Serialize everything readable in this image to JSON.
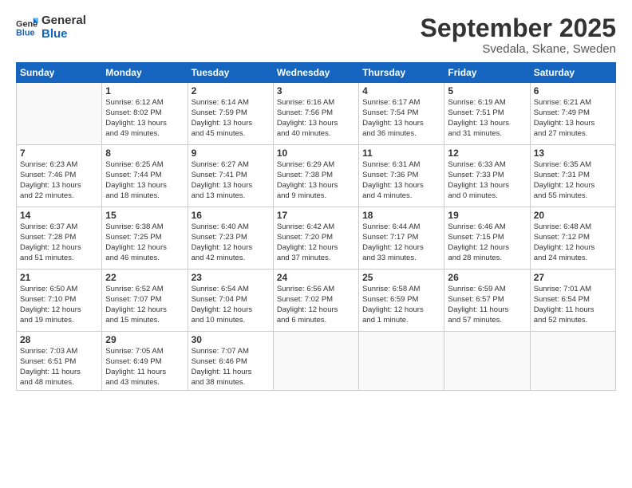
{
  "logo": {
    "line1": "General",
    "line2": "Blue"
  },
  "title": "September 2025",
  "subtitle": "Svedala, Skane, Sweden",
  "days_header": [
    "Sunday",
    "Monday",
    "Tuesday",
    "Wednesday",
    "Thursday",
    "Friday",
    "Saturday"
  ],
  "weeks": [
    [
      {
        "num": "",
        "info": ""
      },
      {
        "num": "1",
        "info": "Sunrise: 6:12 AM\nSunset: 8:02 PM\nDaylight: 13 hours\nand 49 minutes."
      },
      {
        "num": "2",
        "info": "Sunrise: 6:14 AM\nSunset: 7:59 PM\nDaylight: 13 hours\nand 45 minutes."
      },
      {
        "num": "3",
        "info": "Sunrise: 6:16 AM\nSunset: 7:56 PM\nDaylight: 13 hours\nand 40 minutes."
      },
      {
        "num": "4",
        "info": "Sunrise: 6:17 AM\nSunset: 7:54 PM\nDaylight: 13 hours\nand 36 minutes."
      },
      {
        "num": "5",
        "info": "Sunrise: 6:19 AM\nSunset: 7:51 PM\nDaylight: 13 hours\nand 31 minutes."
      },
      {
        "num": "6",
        "info": "Sunrise: 6:21 AM\nSunset: 7:49 PM\nDaylight: 13 hours\nand 27 minutes."
      }
    ],
    [
      {
        "num": "7",
        "info": "Sunrise: 6:23 AM\nSunset: 7:46 PM\nDaylight: 13 hours\nand 22 minutes."
      },
      {
        "num": "8",
        "info": "Sunrise: 6:25 AM\nSunset: 7:44 PM\nDaylight: 13 hours\nand 18 minutes."
      },
      {
        "num": "9",
        "info": "Sunrise: 6:27 AM\nSunset: 7:41 PM\nDaylight: 13 hours\nand 13 minutes."
      },
      {
        "num": "10",
        "info": "Sunrise: 6:29 AM\nSunset: 7:38 PM\nDaylight: 13 hours\nand 9 minutes."
      },
      {
        "num": "11",
        "info": "Sunrise: 6:31 AM\nSunset: 7:36 PM\nDaylight: 13 hours\nand 4 minutes."
      },
      {
        "num": "12",
        "info": "Sunrise: 6:33 AM\nSunset: 7:33 PM\nDaylight: 13 hours\nand 0 minutes."
      },
      {
        "num": "13",
        "info": "Sunrise: 6:35 AM\nSunset: 7:31 PM\nDaylight: 12 hours\nand 55 minutes."
      }
    ],
    [
      {
        "num": "14",
        "info": "Sunrise: 6:37 AM\nSunset: 7:28 PM\nDaylight: 12 hours\nand 51 minutes."
      },
      {
        "num": "15",
        "info": "Sunrise: 6:38 AM\nSunset: 7:25 PM\nDaylight: 12 hours\nand 46 minutes."
      },
      {
        "num": "16",
        "info": "Sunrise: 6:40 AM\nSunset: 7:23 PM\nDaylight: 12 hours\nand 42 minutes."
      },
      {
        "num": "17",
        "info": "Sunrise: 6:42 AM\nSunset: 7:20 PM\nDaylight: 12 hours\nand 37 minutes."
      },
      {
        "num": "18",
        "info": "Sunrise: 6:44 AM\nSunset: 7:17 PM\nDaylight: 12 hours\nand 33 minutes."
      },
      {
        "num": "19",
        "info": "Sunrise: 6:46 AM\nSunset: 7:15 PM\nDaylight: 12 hours\nand 28 minutes."
      },
      {
        "num": "20",
        "info": "Sunrise: 6:48 AM\nSunset: 7:12 PM\nDaylight: 12 hours\nand 24 minutes."
      }
    ],
    [
      {
        "num": "21",
        "info": "Sunrise: 6:50 AM\nSunset: 7:10 PM\nDaylight: 12 hours\nand 19 minutes."
      },
      {
        "num": "22",
        "info": "Sunrise: 6:52 AM\nSunset: 7:07 PM\nDaylight: 12 hours\nand 15 minutes."
      },
      {
        "num": "23",
        "info": "Sunrise: 6:54 AM\nSunset: 7:04 PM\nDaylight: 12 hours\nand 10 minutes."
      },
      {
        "num": "24",
        "info": "Sunrise: 6:56 AM\nSunset: 7:02 PM\nDaylight: 12 hours\nand 6 minutes."
      },
      {
        "num": "25",
        "info": "Sunrise: 6:58 AM\nSunset: 6:59 PM\nDaylight: 12 hours\nand 1 minute."
      },
      {
        "num": "26",
        "info": "Sunrise: 6:59 AM\nSunset: 6:57 PM\nDaylight: 11 hours\nand 57 minutes."
      },
      {
        "num": "27",
        "info": "Sunrise: 7:01 AM\nSunset: 6:54 PM\nDaylight: 11 hours\nand 52 minutes."
      }
    ],
    [
      {
        "num": "28",
        "info": "Sunrise: 7:03 AM\nSunset: 6:51 PM\nDaylight: 11 hours\nand 48 minutes."
      },
      {
        "num": "29",
        "info": "Sunrise: 7:05 AM\nSunset: 6:49 PM\nDaylight: 11 hours\nand 43 minutes."
      },
      {
        "num": "30",
        "info": "Sunrise: 7:07 AM\nSunset: 6:46 PM\nDaylight: 11 hours\nand 38 minutes."
      },
      {
        "num": "",
        "info": ""
      },
      {
        "num": "",
        "info": ""
      },
      {
        "num": "",
        "info": ""
      },
      {
        "num": "",
        "info": ""
      }
    ]
  ]
}
